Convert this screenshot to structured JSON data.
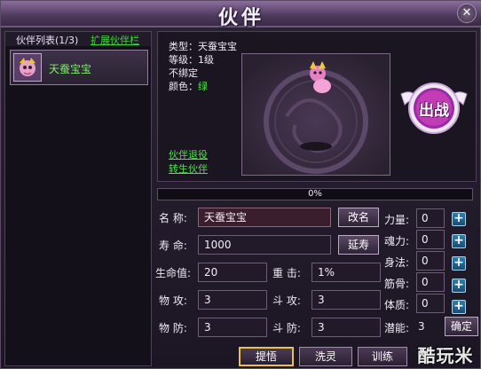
{
  "window": {
    "title": "伙伴"
  },
  "partner_list": {
    "title": "伙伴列表(1/3)",
    "expand_link": "扩展伙伴栏",
    "items": [
      {
        "name": "天蚕宝宝"
      }
    ]
  },
  "info": {
    "type_line": "类型：天蚕宝宝",
    "level_line": "等级：1级",
    "bind_line": "不绑定",
    "color_label": "颜色：",
    "color_value": "绿",
    "retire_link": "伙伴退役",
    "rebirth_link": "转生伙伴",
    "battle_button": "出战"
  },
  "progress": {
    "text": "0%",
    "value": 0
  },
  "attributes": {
    "name_label": "名   称:",
    "name_value": "天蚕宝宝",
    "rename_button": "改名",
    "life_label": "寿   命:",
    "life_value": "1000",
    "extend_button": "延寿",
    "hp_label": "生命值:",
    "hp_value": "20",
    "crit_label": "重   击:",
    "crit_value": "1%",
    "patk_label": "物   攻:",
    "patk_value": "3",
    "datk_label": "斗   攻:",
    "datk_value": "3",
    "pdef_label": "物   防:",
    "pdef_value": "3",
    "ddef_label": "斗   防:",
    "ddef_value": "3"
  },
  "stats": {
    "strength_label": "力量:",
    "strength_value": "0",
    "soul_label": "魂力:",
    "soul_value": "0",
    "agility_label": "身法:",
    "agility_value": "0",
    "bone_label": "筋骨:",
    "bone_value": "0",
    "constitution_label": "体质:",
    "constitution_value": "0",
    "potential_label": "潜能:",
    "potential_value": "3",
    "confirm_button": "确定"
  },
  "tabs": {
    "enlighten": "提悟",
    "wash": "洗灵",
    "train": "训练"
  },
  "watermark": "酷玩米",
  "colors": {
    "accent_green": "#4fe04a",
    "panel": "#1b1522",
    "field": "#3a1e2d"
  }
}
